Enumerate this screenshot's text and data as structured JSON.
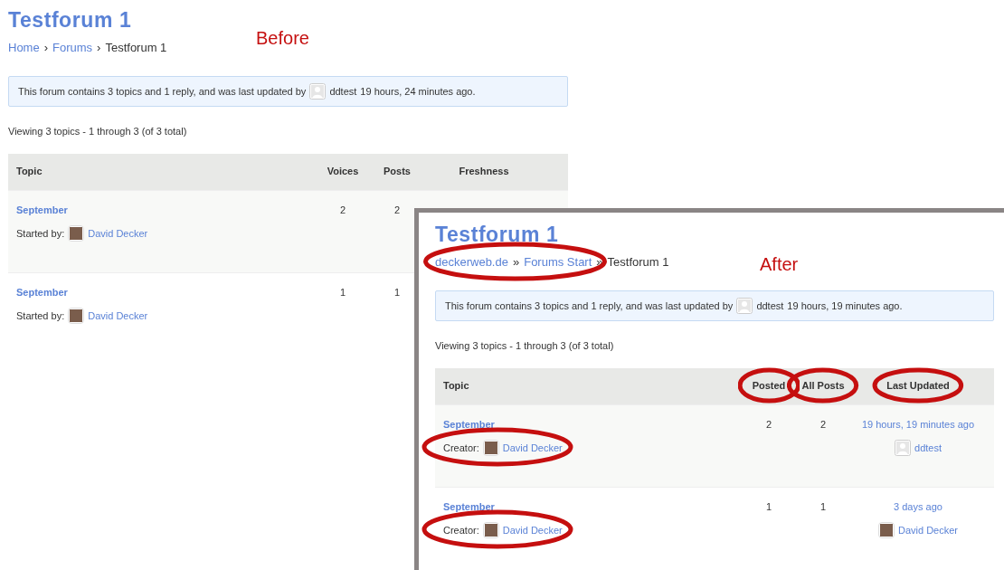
{
  "labels": {
    "before": "Before",
    "after": "After"
  },
  "before": {
    "title": "Testforum 1",
    "breadcrumb": {
      "separator": "›",
      "highlighted": false,
      "items": [
        {
          "label": "Home",
          "link": true
        },
        {
          "label": "Forums",
          "link": true
        },
        {
          "label": "Testforum 1",
          "link": false
        }
      ]
    },
    "notice": {
      "text": "This forum contains 3 topics and 1 reply, and was last updated by",
      "user": "ddtest",
      "time": "19 hours, 24 minutes ago."
    },
    "viewing": "Viewing 3 topics - 1 through 3 (of 3 total)",
    "columns": [
      {
        "label": "Topic",
        "highlighted": false
      },
      {
        "label": "Voices",
        "highlighted": false
      },
      {
        "label": "Posts",
        "highlighted": false
      },
      {
        "label": "Freshness",
        "highlighted": false
      }
    ],
    "rows": [
      {
        "title": "September",
        "creator_label": "Started by:",
        "creator": "David Decker",
        "creator_highlighted": false,
        "count_1": "2",
        "count_2": "2"
      },
      {
        "title": "September",
        "creator_label": "Started by:",
        "creator": "David Decker",
        "creator_highlighted": false,
        "count_1": "1",
        "count_2": "1"
      }
    ]
  },
  "after": {
    "title": "Testforum 1",
    "breadcrumb": {
      "separator": "»",
      "highlighted": true,
      "items": [
        {
          "label": "deckerweb.de",
          "link": true
        },
        {
          "label": "Forums Start",
          "link": true
        },
        {
          "label": "Testforum 1",
          "link": false
        }
      ]
    },
    "notice": {
      "text": "This forum contains 3 topics and 1 reply, and was last updated by",
      "user": "ddtest",
      "time": "19 hours, 19 minutes ago."
    },
    "viewing": "Viewing 3 topics - 1 through 3 (of 3 total)",
    "columns": [
      {
        "label": "Topic",
        "highlighted": false
      },
      {
        "label": "Posted",
        "highlighted": true
      },
      {
        "label": "All Posts",
        "highlighted": true
      },
      {
        "label": "Last Updated",
        "highlighted": true
      }
    ],
    "rows": [
      {
        "title": "September",
        "creator_label": "Creator:",
        "creator": "David Decker",
        "creator_highlighted": true,
        "count_1": "2",
        "count_2": "2",
        "updated": "19 hours, 19 minutes ago",
        "updated_by": {
          "name": "ddtest",
          "kind": "generic"
        }
      },
      {
        "title": "September",
        "creator_label": "Creator:",
        "creator": "David Decker",
        "creator_highlighted": true,
        "count_1": "1",
        "count_2": "1",
        "updated": "3 days ago",
        "updated_by": {
          "name": "David Decker",
          "kind": "photo"
        }
      }
    ]
  }
}
